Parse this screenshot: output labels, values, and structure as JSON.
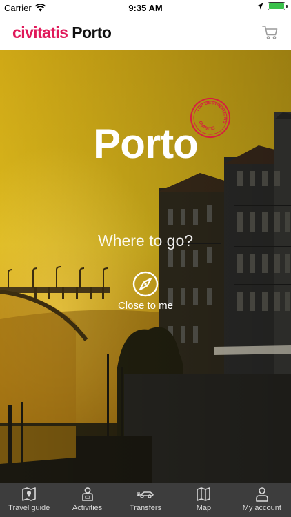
{
  "status_bar": {
    "carrier": "Carrier",
    "time": "9:35 AM",
    "battery_level": 1.0
  },
  "header": {
    "brand": "civitatis",
    "city": "Porto"
  },
  "hero": {
    "title": "Porto",
    "stamp_text_top": "TOP DESTINATIONS",
    "stamp_text_bottom": "CIVITATIS",
    "search_placeholder": "Where to go?",
    "close_to_me_label": "Close to me"
  },
  "bottom_nav": {
    "items": [
      {
        "label": "Travel guide",
        "icon": "map-pin-icon"
      },
      {
        "label": "Activities",
        "icon": "person-badge-icon"
      },
      {
        "label": "Transfers",
        "icon": "car-icon"
      },
      {
        "label": "Map",
        "icon": "map-icon"
      },
      {
        "label": "My account",
        "icon": "user-icon"
      }
    ]
  },
  "colors": {
    "brand": "#e0195a",
    "nav_bg": "#3d3d3d",
    "sky": "#d9b417"
  }
}
